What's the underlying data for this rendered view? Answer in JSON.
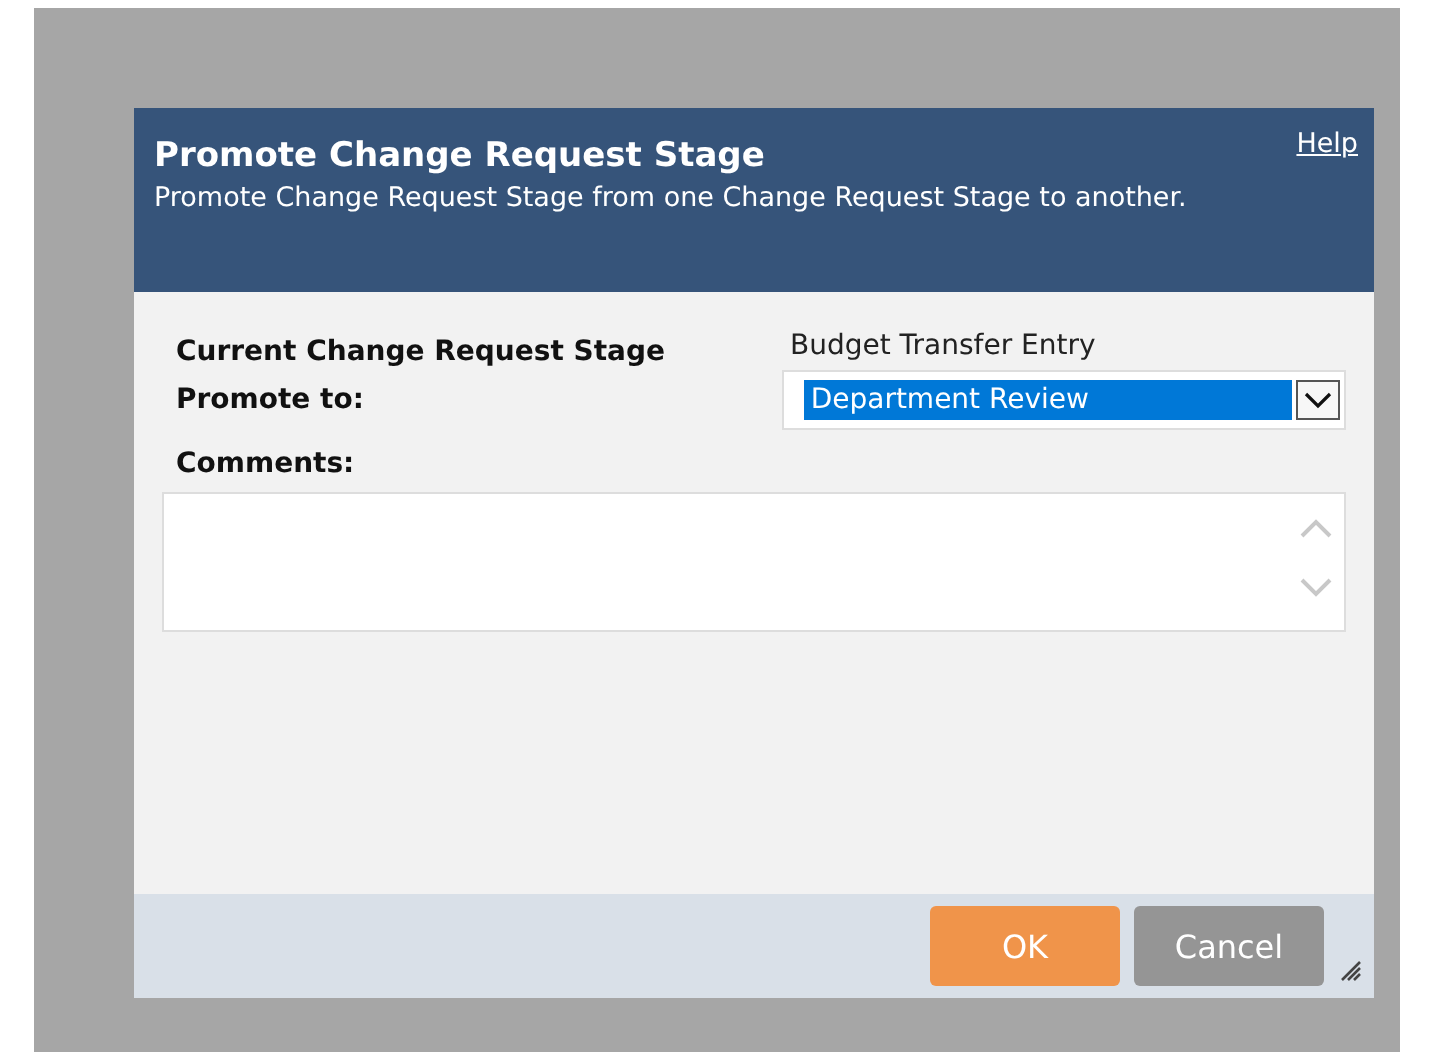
{
  "dialog": {
    "title": "Promote Change Request Stage",
    "subtitle": "Promote Change Request Stage from one Change Request Stage to another.",
    "help_link": "Help",
    "fields": [
      {
        "kind": "text",
        "label": "Current Change Request Stage",
        "value": "Budget Transfer Entry"
      },
      {
        "kind": "select",
        "label": "Promote to:",
        "value": "Department Review"
      }
    ],
    "comments": {
      "label": "Comments:"
    },
    "buttons": [
      {
        "kind": "primary",
        "label": "OK"
      },
      {
        "kind": "secondary",
        "label": "Cancel"
      }
    ]
  }
}
